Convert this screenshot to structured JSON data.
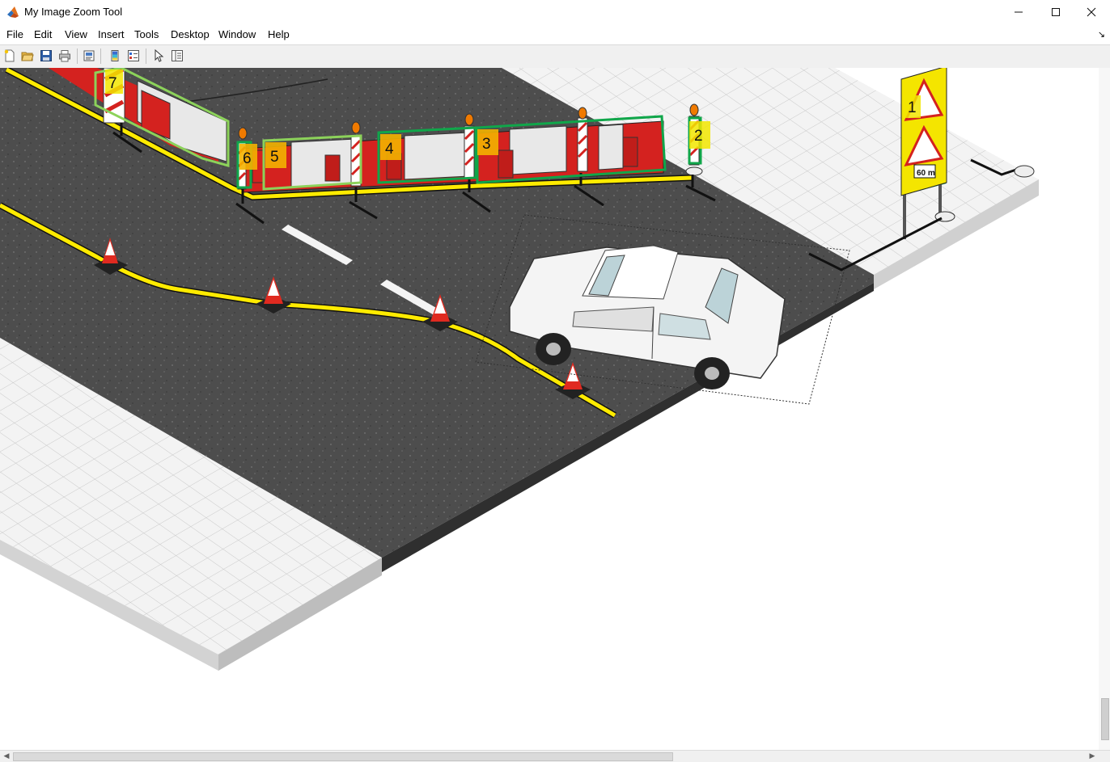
{
  "window": {
    "title": "My Image Zoom Tool",
    "icon": "matlab-icon",
    "controls": [
      "minimize-icon",
      "maximize-icon",
      "close-icon"
    ]
  },
  "menu": {
    "items": [
      "File",
      "Edit",
      "View",
      "Insert",
      "Tools",
      "Desktop",
      "Window",
      "Help"
    ],
    "dock_arrow": "↘"
  },
  "toolbar": {
    "buttons": [
      "new-figure-icon",
      "open-file-icon",
      "save-icon",
      "print-icon",
      "print-preview-icon",
      "colorbar-icon",
      "legend-icon",
      "pointer-icon",
      "property-inspector-icon"
    ]
  },
  "scene": {
    "annotations": [
      "1",
      "2",
      "3",
      "4",
      "5",
      "6",
      "7"
    ],
    "sign_text": "60 m",
    "colors": {
      "road": "#4f4f4f",
      "curb_line": "#ffeb00",
      "box_green": "#10a64a",
      "box_light_green": "#8cd25a",
      "label_yellow": "#f2e600",
      "label_orange": "#f3b200",
      "barrier_red": "#d4221f",
      "barrier_white": "#e8e8e8",
      "sidewalk": "#f1f1f1"
    }
  }
}
